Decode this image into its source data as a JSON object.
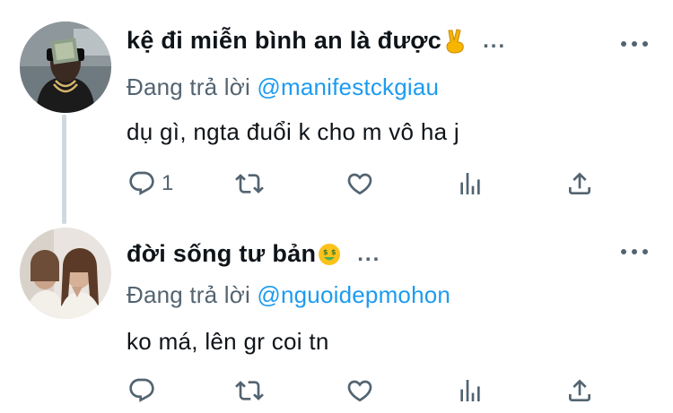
{
  "tweets": [
    {
      "display_name": "kệ đi miễn bình an là được",
      "name_emoji": "victory-hand-emoji",
      "more_dots": "...",
      "reply_prefix": "Đang trả lời ",
      "reply_mention": "@manifestckgiau",
      "text": "dụ gì, ngta đuổi k cho m vô ha j",
      "reply_count": "1"
    },
    {
      "display_name": "đời sống tư bản",
      "name_emoji": "money-mouth-face-emoji",
      "more_dots": "...",
      "reply_prefix": "Đang trả lời ",
      "reply_mention": "@nguoidepmohon",
      "text": "ko má, lên gr coi tn",
      "reply_count": ""
    }
  ],
  "icons": {
    "reply": "speech-bubble-icon",
    "retweet": "retweet-arrows-icon",
    "like": "heart-outline-icon",
    "stats": "bar-chart-icon",
    "share": "share-upload-icon",
    "more": "three-dots-icon"
  },
  "colors": {
    "text": "#0f1419",
    "secondary": "#536471",
    "mention": "#1d9bf0",
    "thread_line": "#cfd9de"
  }
}
